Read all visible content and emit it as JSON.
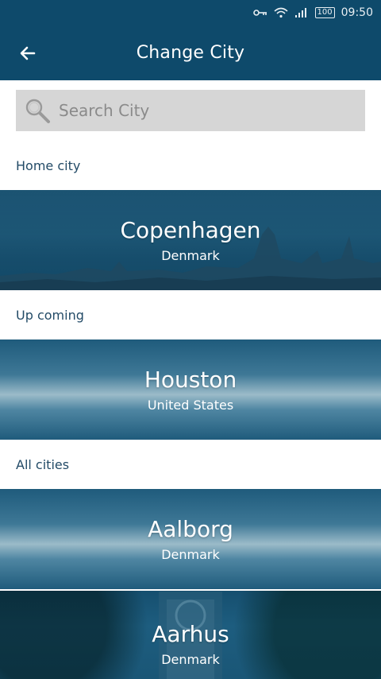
{
  "status_bar": {
    "time": "09:50",
    "battery": "100"
  },
  "header": {
    "title": "Change City"
  },
  "search": {
    "placeholder": "Search City"
  },
  "sections": {
    "home": "Home city",
    "upcoming": "Up coming",
    "all": "All cities"
  },
  "cities": {
    "home": {
      "name": "Copenhagen",
      "country": "Denmark"
    },
    "upcoming": {
      "name": "Houston",
      "country": "United States"
    },
    "all": [
      {
        "name": "Aalborg",
        "country": "Denmark"
      },
      {
        "name": "Aarhus",
        "country": "Denmark"
      }
    ]
  },
  "colors": {
    "header": "#0e4a6b",
    "section_text": "#234b67",
    "search_bg": "#d6d6d6"
  },
  "icons": {
    "back": "arrow-left-icon",
    "search": "magnifier-icon",
    "key": "key-icon",
    "wifi": "wifi-icon",
    "signal": "signal-icon",
    "battery": "battery-icon"
  }
}
